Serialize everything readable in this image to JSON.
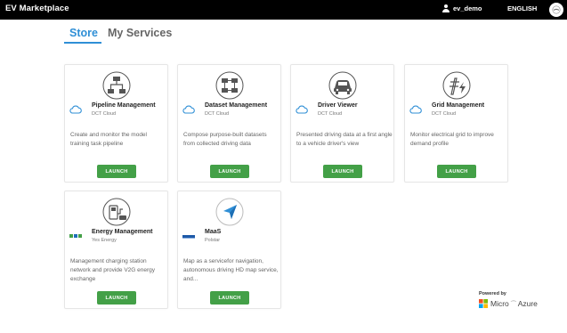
{
  "header": {
    "brand": "EV Marketplace",
    "username": "ev_demo",
    "language": "ENGLISH"
  },
  "tabs": [
    {
      "label": "Store",
      "active": true
    },
    {
      "label": "My Services",
      "active": false
    }
  ],
  "cards": [
    {
      "title": "Pipeline Management",
      "provider": "DCT Cloud",
      "description": "Create and monitor the model training task pipeline",
      "button": "LAUNCH",
      "icon": "pipeline-icon",
      "provider_logo": "cloud-icon"
    },
    {
      "title": "Dataset Management",
      "provider": "DCT Cloud",
      "description": "Compose purpose-built datasets from collected driving data",
      "button": "LAUNCH",
      "icon": "dataset-icon",
      "provider_logo": "cloud-icon"
    },
    {
      "title": "Driver Viewer",
      "provider": "DCT Cloud",
      "description": "Presented driving data at a first angle to a vehicle driver's view",
      "button": "LAUNCH",
      "icon": "car-icon",
      "provider_logo": "cloud-icon"
    },
    {
      "title": "Grid Management",
      "provider": "DCT Cloud",
      "description": "Monitor electrical grid to improve demand profile",
      "button": "LAUNCH",
      "icon": "grid-icon",
      "provider_logo": "cloud-icon"
    },
    {
      "title": "Energy Management",
      "provider": "Yes Energy",
      "description": "Management charging station network and provide V2G energy exchange",
      "button": "LAUNCH",
      "icon": "energy-icon",
      "provider_logo": "yes-energy-logo"
    },
    {
      "title": "MaaS",
      "provider": "Polstar",
      "description": "Map as a servicefor navigation, autonomous driving HD map service, and...",
      "button": "LAUNCH",
      "icon": "navigation-icon",
      "provider_logo": "polstar-logo"
    }
  ],
  "footer": {
    "powered_by": "Powered by",
    "brand": "Micro",
    "brand_suffix": "Azure"
  },
  "colors": {
    "accent": "#2f8fd6",
    "launch": "#43a047",
    "header_bg": "#000000"
  }
}
